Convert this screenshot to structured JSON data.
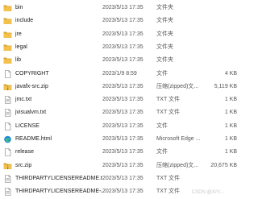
{
  "files": [
    {
      "name": "bin",
      "date": "2023/5/13 17:35",
      "type": "文件夹",
      "size": "",
      "icon": "folder-icon"
    },
    {
      "name": "include",
      "date": "2023/5/13 17:35",
      "type": "文件夹",
      "size": "",
      "icon": "folder-icon"
    },
    {
      "name": "jre",
      "date": "2023/5/13 17:35",
      "type": "文件夹",
      "size": "",
      "icon": "folder-icon"
    },
    {
      "name": "legal",
      "date": "2023/5/13 17:35",
      "type": "文件夹",
      "size": "",
      "icon": "folder-icon"
    },
    {
      "name": "lib",
      "date": "2023/5/13 17:35",
      "type": "文件夹",
      "size": "",
      "icon": "folder-icon"
    },
    {
      "name": "COPYRIGHT",
      "date": "2023/1/9 8:59",
      "type": "文件",
      "size": "4 KB",
      "icon": "file-icon"
    },
    {
      "name": "javafx-src.zip",
      "date": "2023/5/13 17:35",
      "type": "压缩(zipped)文...",
      "size": "5,119 KB",
      "icon": "zip-icon"
    },
    {
      "name": "jmc.txt",
      "date": "2023/5/13 17:35",
      "type": "TXT 文件",
      "size": "1 KB",
      "icon": "text-file-icon"
    },
    {
      "name": "jvisualvm.txt",
      "date": "2023/5/13 17:35",
      "type": "TXT 文件",
      "size": "1 KB",
      "icon": "text-file-icon"
    },
    {
      "name": "LICENSE",
      "date": "2023/5/13 17:35",
      "type": "文件",
      "size": "1 KB",
      "icon": "file-icon"
    },
    {
      "name": "README.html",
      "date": "2023/5/13 17:35",
      "type": "Microsoft Edge ...",
      "size": "1 KB",
      "icon": "edge-icon"
    },
    {
      "name": "release",
      "date": "2023/5/13 17:35",
      "type": "文件",
      "size": "1 KB",
      "icon": "file-icon"
    },
    {
      "name": "src.zip",
      "date": "2023/5/13 17:35",
      "type": "压缩(zipped)文...",
      "size": "20,675 KB",
      "icon": "zip-icon"
    },
    {
      "name": "THIRDPARTYLICENSEREADME.txt",
      "date": "2023/5/13 17:35",
      "type": "TXT 文件",
      "size": "",
      "icon": "text-file-icon"
    },
    {
      "name": "THIRDPARTYLICENSEREADME-JAV...",
      "date": "2023/5/13 17:35",
      "type": "TXT 文件",
      "size": "",
      "icon": "text-file-icon"
    }
  ],
  "watermark": "CSDN @XiYi...",
  "colors": {
    "folder": "#f2c14e",
    "folder_dark": "#dca52c",
    "zip": "#f2c14e",
    "edge": "#1f8ad9",
    "file_border": "#7a7a7a"
  }
}
